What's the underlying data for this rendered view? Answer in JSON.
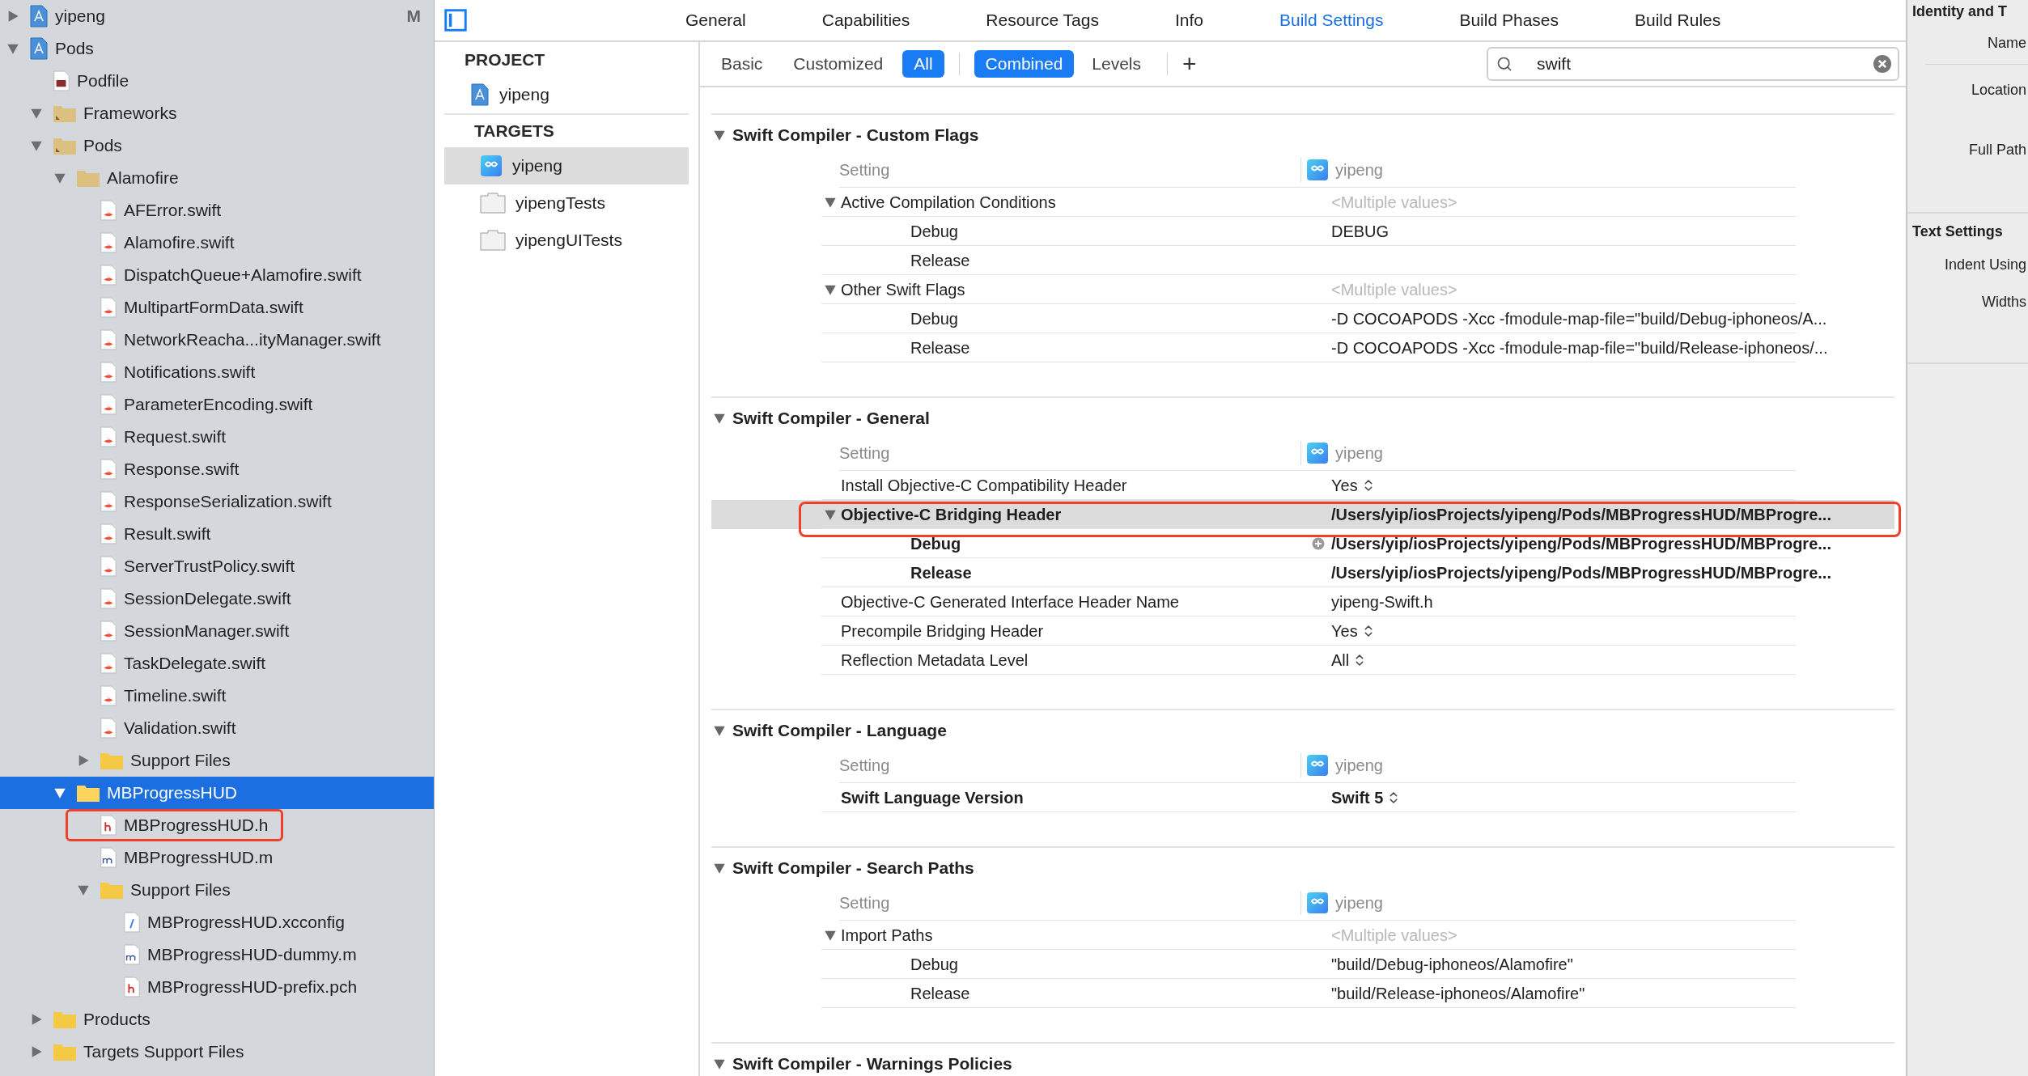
{
  "navigator": {
    "items": [
      {
        "name": "yipeng",
        "kind": "project",
        "expanded": false,
        "selected": false,
        "outlined": false,
        "badge": "M"
      },
      {
        "name": "Pods",
        "kind": "project",
        "expanded": true,
        "selected": false,
        "outlined": false,
        "children": [
          {
            "name": "Podfile",
            "kind": "ruby",
            "selected": false,
            "outlined": false
          },
          {
            "name": "Frameworks",
            "kind": "group",
            "expanded": true,
            "selected": false,
            "outlined": false
          },
          {
            "name": "Pods",
            "kind": "group",
            "expanded": true,
            "selected": false,
            "outlined": false,
            "children": [
              {
                "name": "Alamofire",
                "kind": "group-plain",
                "expanded": true,
                "selected": false,
                "outlined": false,
                "children": [
                  {
                    "name": "AFError.swift",
                    "kind": "swift",
                    "selected": false,
                    "outlined": false
                  },
                  {
                    "name": "Alamofire.swift",
                    "kind": "swift",
                    "selected": false,
                    "outlined": false
                  },
                  {
                    "name": "DispatchQueue+Alamofire.swift",
                    "kind": "swift",
                    "selected": false,
                    "outlined": false
                  },
                  {
                    "name": "MultipartFormData.swift",
                    "kind": "swift",
                    "selected": false,
                    "outlined": false
                  },
                  {
                    "name": "NetworkReacha...ityManager.swift",
                    "kind": "swift",
                    "selected": false,
                    "outlined": false
                  },
                  {
                    "name": "Notifications.swift",
                    "kind": "swift",
                    "selected": false,
                    "outlined": false
                  },
                  {
                    "name": "ParameterEncoding.swift",
                    "kind": "swift",
                    "selected": false,
                    "outlined": false
                  },
                  {
                    "name": "Request.swift",
                    "kind": "swift",
                    "selected": false,
                    "outlined": false
                  },
                  {
                    "name": "Response.swift",
                    "kind": "swift",
                    "selected": false,
                    "outlined": false
                  },
                  {
                    "name": "ResponseSerialization.swift",
                    "kind": "swift",
                    "selected": false,
                    "outlined": false
                  },
                  {
                    "name": "Result.swift",
                    "kind": "swift",
                    "selected": false,
                    "outlined": false
                  },
                  {
                    "name": "ServerTrustPolicy.swift",
                    "kind": "swift",
                    "selected": false,
                    "outlined": false
                  },
                  {
                    "name": "SessionDelegate.swift",
                    "kind": "swift",
                    "selected": false,
                    "outlined": false
                  },
                  {
                    "name": "SessionManager.swift",
                    "kind": "swift",
                    "selected": false,
                    "outlined": false
                  },
                  {
                    "name": "TaskDelegate.swift",
                    "kind": "swift",
                    "selected": false,
                    "outlined": false
                  },
                  {
                    "name": "Timeline.swift",
                    "kind": "swift",
                    "selected": false,
                    "outlined": false
                  },
                  {
                    "name": "Validation.swift",
                    "kind": "swift",
                    "selected": false,
                    "outlined": false
                  },
                  {
                    "name": "Support Files",
                    "kind": "folder",
                    "expanded": false,
                    "selected": false,
                    "outlined": false
                  }
                ]
              },
              {
                "name": "MBProgressHUD",
                "kind": "folder",
                "expanded": true,
                "selected": true,
                "outlined": false,
                "children": [
                  {
                    "name": "MBProgressHUD.h",
                    "kind": "header",
                    "selected": false,
                    "outlined": true
                  },
                  {
                    "name": "MBProgressHUD.m",
                    "kind": "impl",
                    "selected": false,
                    "outlined": false
                  },
                  {
                    "name": "Support Files",
                    "kind": "folder",
                    "expanded": true,
                    "selected": false,
                    "outlined": false,
                    "children": [
                      {
                        "name": "MBProgressHUD.xcconfig",
                        "kind": "xcconfig",
                        "selected": false,
                        "outlined": false
                      },
                      {
                        "name": "MBProgressHUD-dummy.m",
                        "kind": "impl",
                        "selected": false,
                        "outlined": false
                      },
                      {
                        "name": "MBProgressHUD-prefix.pch",
                        "kind": "header",
                        "selected": false,
                        "outlined": false
                      }
                    ]
                  }
                ]
              }
            ]
          },
          {
            "name": "Products",
            "kind": "folder",
            "expanded": false,
            "selected": false,
            "outlined": false
          },
          {
            "name": "Targets Support Files",
            "kind": "folder",
            "expanded": false,
            "selected": false,
            "outlined": false
          }
        ]
      }
    ]
  },
  "editor_tabs": [
    {
      "label": "General",
      "selected": false
    },
    {
      "label": "Capabilities",
      "selected": false
    },
    {
      "label": "Resource Tags",
      "selected": false
    },
    {
      "label": "Info",
      "selected": false
    },
    {
      "label": "Build Settings",
      "selected": true
    },
    {
      "label": "Build Phases",
      "selected": false
    },
    {
      "label": "Build Rules",
      "selected": false
    }
  ],
  "targets_list": {
    "groups": [
      {
        "title": "PROJECT",
        "items": [
          {
            "name": "yipeng",
            "kind": "project",
            "selected": false
          }
        ]
      },
      {
        "title": "TARGETS",
        "items": [
          {
            "name": "yipeng",
            "kind": "app",
            "selected": true
          },
          {
            "name": "yipengTests",
            "kind": "test",
            "selected": false
          },
          {
            "name": "yipengUITests",
            "kind": "test",
            "selected": false
          }
        ]
      }
    ]
  },
  "filter_bar": {
    "scope": [
      {
        "label": "Basic",
        "selected": false
      },
      {
        "label": "Customized",
        "selected": false
      },
      {
        "label": "All",
        "selected": true
      }
    ],
    "view": [
      {
        "label": "Combined",
        "selected": true
      },
      {
        "label": "Levels",
        "selected": false
      }
    ],
    "add_label": "+",
    "search": {
      "value": "swift"
    }
  },
  "settings": {
    "sections": [
      {
        "title": "Swift Compiler - Custom Flags",
        "expanded": true,
        "header": {
          "label": "Setting",
          "target": "yipeng"
        },
        "rows": [
          {
            "kind": "group",
            "name": "Active Compilation Conditions",
            "value": "<Multiple values>",
            "dim": true,
            "expanded": true,
            "selected": false,
            "outlined": false
          },
          {
            "kind": "config",
            "name": "Debug",
            "value": "DEBUG",
            "selected": false,
            "outlined": false
          },
          {
            "kind": "config",
            "name": "Release",
            "selected": false,
            "outlined": false
          },
          {
            "kind": "group",
            "name": "Other Swift Flags",
            "value": "<Multiple values>",
            "dim": true,
            "expanded": true,
            "selected": false,
            "outlined": false
          },
          {
            "kind": "config",
            "name": "Debug",
            "value": "-D COCOAPODS -Xcc -fmodule-map-file=\"build/Debug-iphoneos/A...",
            "selected": false,
            "outlined": false
          },
          {
            "kind": "config",
            "name": "Release",
            "value": "-D COCOAPODS -Xcc -fmodule-map-file=\"build/Release-iphoneos/...",
            "selected": false,
            "outlined": false
          }
        ]
      },
      {
        "title": "Swift Compiler - General",
        "expanded": true,
        "header": {
          "label": "Setting",
          "target": "yipeng"
        },
        "rows": [
          {
            "kind": "setting",
            "name": "Install Objective-C Compatibility Header",
            "value": "Yes",
            "popup": true,
            "selected": false,
            "outlined": false
          },
          {
            "kind": "group",
            "name": "Objective-C Bridging Header",
            "value": "/Users/yip/iosProjects/yipeng/Pods/MBProgressHUD/MBProgre...",
            "bold": true,
            "expanded": true,
            "selected": true,
            "outlined": true
          },
          {
            "kind": "config",
            "name": "Debug",
            "value": "/Users/yip/iosProjects/yipeng/Pods/MBProgressHUD/MBProgre...",
            "bold": true,
            "add_button": true,
            "selected": false,
            "outlined": false
          },
          {
            "kind": "config",
            "name": "Release",
            "value": "/Users/yip/iosProjects/yipeng/Pods/MBProgressHUD/MBProgre...",
            "bold": true,
            "selected": false,
            "outlined": false
          },
          {
            "kind": "setting",
            "name": "Objective-C Generated Interface Header Name",
            "value": "yipeng-Swift.h",
            "selected": false,
            "outlined": false
          },
          {
            "kind": "setting",
            "name": "Precompile Bridging Header",
            "value": "Yes",
            "popup": true,
            "selected": false,
            "outlined": false
          },
          {
            "kind": "setting",
            "name": "Reflection Metadata Level",
            "value": "All",
            "popup": true,
            "selected": false,
            "outlined": false
          }
        ]
      },
      {
        "title": "Swift Compiler - Language",
        "expanded": true,
        "header": {
          "label": "Setting",
          "target": "yipeng"
        },
        "rows": [
          {
            "kind": "setting",
            "name": "Swift Language Version",
            "value": "Swift 5",
            "popup": true,
            "bold": true,
            "selected": false,
            "outlined": false
          }
        ]
      },
      {
        "title": "Swift Compiler - Search Paths",
        "expanded": true,
        "header": {
          "label": "Setting",
          "target": "yipeng"
        },
        "rows": [
          {
            "kind": "group",
            "name": "Import Paths",
            "value": "<Multiple values>",
            "dim": true,
            "expanded": true,
            "selected": false,
            "outlined": false
          },
          {
            "kind": "config",
            "name": "Debug",
            "value": "\"build/Debug-iphoneos/Alamofire\"",
            "selected": false,
            "outlined": false
          },
          {
            "kind": "config",
            "name": "Release",
            "value": "\"build/Release-iphoneos/Alamofire\"",
            "selected": false,
            "outlined": false
          }
        ]
      },
      {
        "title": "Swift Compiler - Warnings Policies",
        "expanded": true
      }
    ]
  },
  "inspector": {
    "sections": [
      {
        "title": "Identity and T",
        "fields": [
          "Name",
          "Location",
          "Full Path"
        ]
      },
      {
        "title": "Text Settings",
        "fields": [
          "Indent Using",
          "Widths"
        ]
      }
    ]
  }
}
